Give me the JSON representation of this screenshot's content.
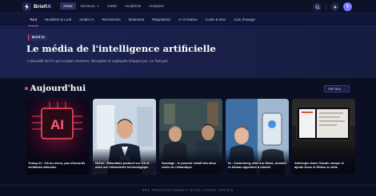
{
  "brand": {
    "name_main": "Brief",
    "name_accent": "IA",
    "logo_icon": "bolt-icon"
  },
  "topnav": {
    "items": [
      {
        "label": "Actus",
        "active": true,
        "has_dropdown": false
      },
      {
        "label": "Secteurs",
        "active": false,
        "has_dropdown": true
      },
      {
        "label": "Outils",
        "active": false,
        "has_dropdown": false
      },
      {
        "label": "Académie",
        "active": false,
        "has_dropdown": false
      },
      {
        "label": "Analyses",
        "active": false,
        "has_dropdown": false
      }
    ],
    "search_icon": "search-icon",
    "theme_icon": "sun-icon",
    "avatar_initial": "T"
  },
  "categories": [
    {
      "label": "Tout",
      "active": true
    },
    {
      "label": "Modèles & LLM",
      "active": false
    },
    {
      "label": "Outils IA",
      "active": false
    },
    {
      "label": "Recherche",
      "active": false
    },
    {
      "label": "Business",
      "active": false
    },
    {
      "label": "Régulation",
      "active": false
    },
    {
      "label": "IA Créative",
      "active": false
    },
    {
      "label": "Code & Dev",
      "active": false
    },
    {
      "label": "Cas d'usage",
      "active": false
    }
  ],
  "hero": {
    "badge": "Brief IA",
    "title": "Le média de l'intelligence artificielle",
    "subtitle": "L'actualité de l'IA qui compte vraiment, décryptée et expliquée chaque jour, en français."
  },
  "today": {
    "title": "Aujourd'hui",
    "see_all": "Voir tout",
    "see_all_icon": "arrow-right-icon",
    "cards": [
      {
        "caption": "Trump-Xi : l'IA au menu, pas d'accords véritables attendus",
        "image": "ai-chip-image"
      },
      {
        "caption": "Grèce : Mitsotakis prudent sur l'IA et mise sur l'attractivité technologique",
        "image": "politician-speech-image"
      },
      {
        "caption": "Sondage : le pouvoir relatif des deux côtés de l'Atlantique",
        "image": "leaders-meeting-image"
      },
      {
        "caption": "IA : Zuckerberg mise sur Musk, Amodei et Altman appellent à ralentir",
        "image": "tech-ceos-image"
      },
      {
        "caption": "Anthropic lance Claude unique et ajoute Docs et Slides en bêta",
        "image": "office-screen-image"
      }
    ]
  },
  "footer": {
    "text": "DES PROFESSIONNELS NOUS LISENT DEPUIS"
  },
  "colors": {
    "accent": "#e4455f",
    "background": "#0b0f24",
    "hero": "#1b2250",
    "active_nav": "#2a3160"
  }
}
